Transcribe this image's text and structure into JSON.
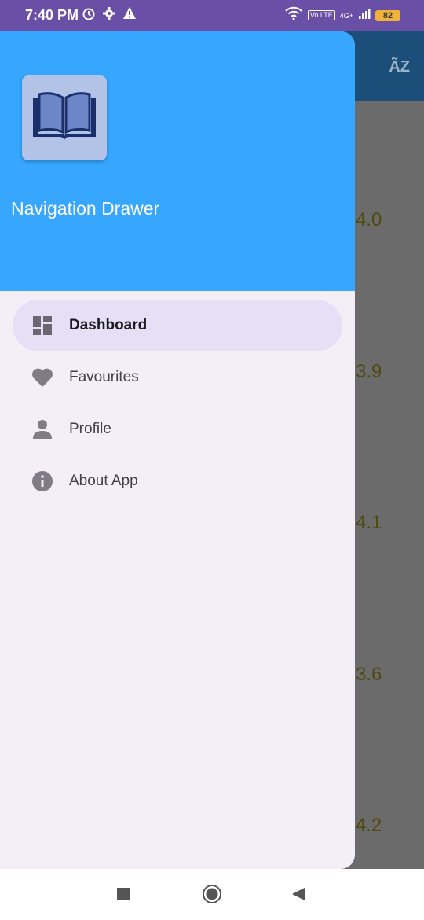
{
  "status_bar": {
    "time": "7:40 PM",
    "network": "4G+",
    "volte": "Vo LTE",
    "battery": "82"
  },
  "background_app": {
    "ratings": [
      "4.0",
      "3.9",
      "4.1",
      "3.6",
      "4.2"
    ]
  },
  "drawer": {
    "title": "Navigation Drawer",
    "header_color": "#36a6ff",
    "items": [
      {
        "label": "Dashboard",
        "icon": "dashboard-icon",
        "active": true
      },
      {
        "label": "Favourites",
        "icon": "heart-icon",
        "active": false
      },
      {
        "label": "Profile",
        "icon": "person-icon",
        "active": false
      },
      {
        "label": "About App",
        "icon": "info-icon",
        "active": false
      }
    ]
  },
  "nav_bar": {
    "buttons": [
      "recents-button",
      "home-button",
      "back-button"
    ]
  }
}
